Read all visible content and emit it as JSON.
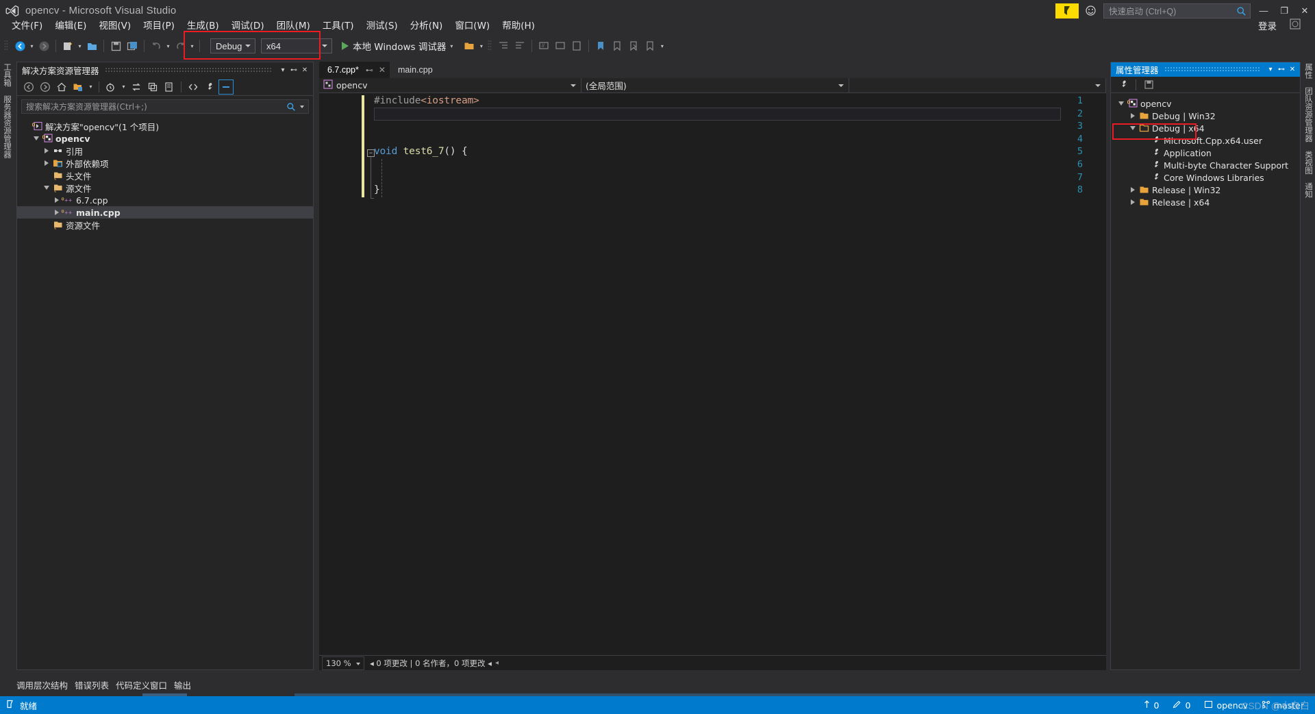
{
  "window": {
    "title": "opencv - Microsoft Visual Studio",
    "logo_icon": "visual-studio-logo",
    "minimize_label": "—",
    "maximize_label": "❐",
    "close_label": "✕"
  },
  "title_right": {
    "notification_icon": "notification-flag-icon",
    "feedback_icon": "feedback-smiley-icon",
    "quick_launch_placeholder": "快速启动 (Ctrl+Q)",
    "quick_launch_icon": "search-icon"
  },
  "menu": {
    "items": [
      "文件(F)",
      "编辑(E)",
      "视图(V)",
      "项目(P)",
      "生成(B)",
      "调试(D)",
      "团队(M)",
      "工具(T)",
      "测试(S)",
      "分析(N)",
      "窗口(W)",
      "帮助(H)"
    ],
    "signin_label": "登录",
    "smiley_icon": "feedback-smiley-icon"
  },
  "toolbar": {
    "navigate_back_icon": "navigate-back-icon",
    "navigate_forward_icon": "navigate-forward-icon",
    "new_project_icon": "new-project-icon",
    "open_file_icon": "open-file-icon",
    "save_icon": "save-icon",
    "save_all_icon": "save-all-icon",
    "undo_icon": "undo-icon",
    "redo_icon": "redo-icon",
    "config_value": "Debug",
    "platform_value": "x64",
    "run_label": "本地 Windows 调试器",
    "run_icon": "play-icon",
    "extra_icons": [
      "folder-icon",
      "step-icon",
      "indent-icon",
      "outdent-icon",
      "comment-icon",
      "uncomment-icon",
      "bookmark-icon",
      "toggle-bookmark-icon",
      "next-bookmark-icon",
      "prev-bookmark-icon"
    ]
  },
  "left_vtabs": [
    "工具箱",
    "服务器资源管理器"
  ],
  "right_vtabs": [
    "属性",
    "团队资源管理器",
    "类视图",
    "通知"
  ],
  "solution_explorer": {
    "title": "解决方案资源管理器",
    "dropdown_icon": "chevron-down-icon",
    "pin_icon": "pin-icon",
    "close_icon": "close-icon",
    "toolbar_icons": [
      "back-icon",
      "forward-icon",
      "home-icon",
      "new-folder-icon",
      "pending-changes-icon",
      "sync-icon",
      "collapse-all-icon",
      "refresh-icon",
      "show-all-files-icon",
      "properties-icon",
      "preview-selected-icon"
    ],
    "search_placeholder": "搜索解决方案资源管理器(Ctrl+;)",
    "search_icon": "search-icon",
    "tree": [
      {
        "label": "解决方案\"opencv\"(1 个项目)",
        "depth": 0,
        "twisty": "none",
        "icon": "solution-icon",
        "selected": false,
        "bold": false
      },
      {
        "label": "opencv",
        "depth": 1,
        "twisty": "open",
        "icon": "cpp-project-icon",
        "selected": false,
        "bold": true
      },
      {
        "label": "引用",
        "depth": 2,
        "twisty": "closed",
        "icon": "references-icon",
        "selected": false,
        "bold": false
      },
      {
        "label": "外部依赖项",
        "depth": 2,
        "twisty": "closed",
        "icon": "ext-deps-icon",
        "selected": false,
        "bold": false
      },
      {
        "label": "头文件",
        "depth": 2,
        "twisty": "none",
        "icon": "filter-folder-icon",
        "selected": false,
        "bold": false
      },
      {
        "label": "源文件",
        "depth": 2,
        "twisty": "open",
        "icon": "filter-folder-icon",
        "selected": false,
        "bold": false
      },
      {
        "label": "6.7.cpp",
        "depth": 3,
        "twisty": "closed",
        "icon": "cpp-file-icon",
        "selected": false,
        "bold": false
      },
      {
        "label": "main.cpp",
        "depth": 3,
        "twisty": "closed",
        "icon": "cpp-file-icon",
        "selected": true,
        "bold": true
      },
      {
        "label": "资源文件",
        "depth": 2,
        "twisty": "none",
        "icon": "filter-folder-icon",
        "selected": false,
        "bold": false
      }
    ]
  },
  "property_manager": {
    "title": "属性管理器",
    "dropdown_icon": "chevron-down-icon",
    "pin_icon": "pin-icon",
    "close_icon": "close-icon",
    "toolbar_icons": [
      "properties-wrench-icon",
      "save-icon"
    ],
    "tree": [
      {
        "label": "opencv",
        "depth": 0,
        "twisty": "open",
        "icon": "cpp-project-icon",
        "highlight": false
      },
      {
        "label": "Debug | Win32",
        "depth": 1,
        "twisty": "closed",
        "icon": "folder-icon",
        "highlight": false
      },
      {
        "label": "Debug | x64",
        "depth": 1,
        "twisty": "open",
        "icon": "folder-open-icon",
        "highlight": true
      },
      {
        "label": "Microsoft.Cpp.x64.user",
        "depth": 2,
        "twisty": "none",
        "icon": "wrench-icon",
        "highlight": false
      },
      {
        "label": "Application",
        "depth": 2,
        "twisty": "none",
        "icon": "wrench-icon",
        "highlight": false
      },
      {
        "label": "Multi-byte Character Support",
        "depth": 2,
        "twisty": "none",
        "icon": "wrench-icon",
        "highlight": false
      },
      {
        "label": "Core Windows Libraries",
        "depth": 2,
        "twisty": "none",
        "icon": "wrench-icon",
        "highlight": false
      },
      {
        "label": "Release | Win32",
        "depth": 1,
        "twisty": "closed",
        "icon": "folder-icon",
        "highlight": false
      },
      {
        "label": "Release | x64",
        "depth": 1,
        "twisty": "closed",
        "icon": "folder-icon",
        "highlight": false
      }
    ]
  },
  "editor": {
    "tabs": [
      {
        "label": "6.7.cpp*",
        "active": true,
        "pin_icon": "pin-icon",
        "close_icon": "close-icon"
      },
      {
        "label": "main.cpp",
        "active": false,
        "pin_icon": "pin-icon",
        "close_icon": "close-icon"
      }
    ],
    "nav_project": "opencv",
    "nav_project_icon": "cpp-project-icon",
    "nav_scope": "(全局范围)",
    "nav_member": "",
    "lines": [
      {
        "n": 1,
        "text": "#include<iostream>"
      },
      {
        "n": 2,
        "text": ""
      },
      {
        "n": 3,
        "text": ""
      },
      {
        "n": 4,
        "text": ""
      },
      {
        "n": 5,
        "text": "void test6_7() {"
      },
      {
        "n": 6,
        "text": ""
      },
      {
        "n": 7,
        "text": ""
      },
      {
        "n": 8,
        "text": "}"
      }
    ],
    "status": {
      "zoom": "130 %",
      "git_changes": "◂ 0 项更改 | 0 名作者，0 项更改 ◂"
    }
  },
  "bottom_tabs": [
    "调用层次结构",
    "错误列表",
    "代码定义窗口",
    "输出"
  ],
  "statusbar": {
    "ready_label": "就绪",
    "ready_icon": "status-flag-icon",
    "up_icon": "arrow-up-icon",
    "up_count": "0",
    "pencil_icon": "pencil-icon",
    "pencil_count": "0",
    "repo_icon": "repo-icon",
    "repo_label": "opencv",
    "branch_icon": "branch-icon",
    "branch_label": "master",
    "watermark": "CSDN @小白白"
  },
  "colors": {
    "accent": "#007acc",
    "highlight_red": "#ec1c24",
    "chrome": "#2d2d30",
    "panel": "#252526",
    "editor_bg": "#1e1e1e",
    "line_number": "#2b91af",
    "keyword": "#569cd6",
    "change_bar": "#e8e6a0",
    "notification_yellow": "#fcdc00"
  }
}
